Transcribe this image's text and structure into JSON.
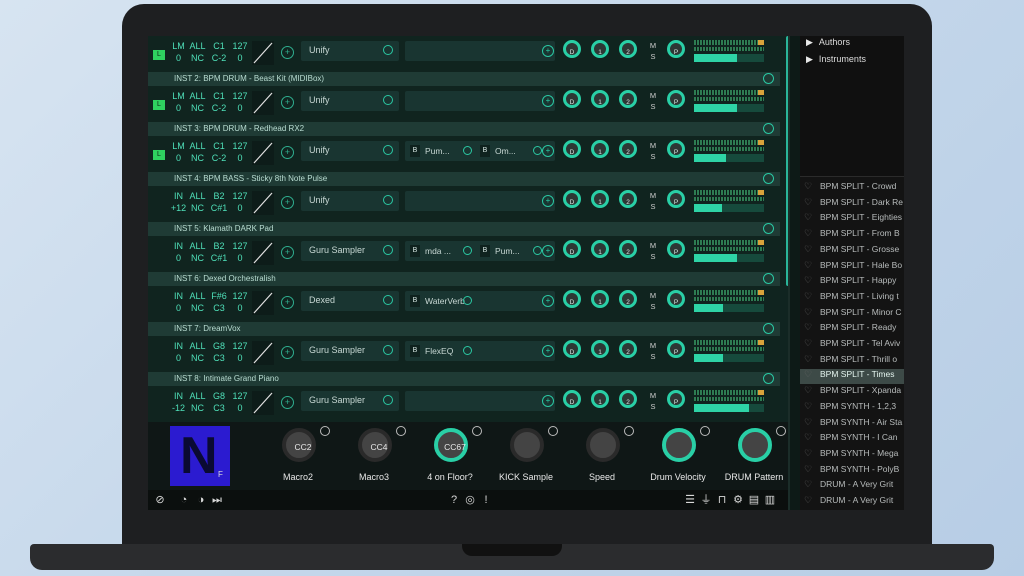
{
  "instruments": [
    {
      "header": "",
      "lm": [
        "LM",
        "ALL",
        "C1",
        "127"
      ],
      "row2": [
        "0",
        "NC",
        "C-2",
        "0"
      ],
      "led": "L",
      "plugin": "Unify",
      "fx": [],
      "fader": 0.62
    },
    {
      "header": "INST 2:  BPM DRUM - Beast Kit (MIDIBox)",
      "lm": [
        "LM",
        "ALL",
        "C1",
        "127"
      ],
      "row2": [
        "0",
        "NC",
        "C-2",
        "0"
      ],
      "led": "L",
      "plugin": "Unify",
      "fx": [],
      "fader": 0.62
    },
    {
      "header": "INST 3:  BPM DRUM - Redhead RX2",
      "lm": [
        "LM",
        "ALL",
        "C1",
        "127"
      ],
      "row2": [
        "0",
        "NC",
        "C-2",
        "0"
      ],
      "led": "L",
      "plugin": "Unify",
      "fx": [
        {
          "b": "B",
          "label": "Pum..."
        },
        {
          "b": "B",
          "label": "Om..."
        }
      ],
      "fader": 0.45
    },
    {
      "header": "INST 4:  BPM BASS - Sticky 8th Note Pulse",
      "lm": [
        "IN",
        "ALL",
        "B2",
        "127"
      ],
      "row2": [
        "+12",
        "NC",
        "C#1",
        "0"
      ],
      "led": "",
      "plugin": "Unify",
      "fx": [],
      "fader": 0.4
    },
    {
      "header": "INST 5:  Klamath DARK Pad",
      "lm": [
        "IN",
        "ALL",
        "B2",
        "127"
      ],
      "row2": [
        "0",
        "NC",
        "C#1",
        "0"
      ],
      "led": "",
      "plugin": "Guru Sampler",
      "fx": [
        {
          "b": "B",
          "label": "mda ..."
        },
        {
          "b": "B",
          "label": "Pum..."
        }
      ],
      "fader": 0.62
    },
    {
      "header": "INST 6:  Dexed Orchestralish",
      "lm": [
        "IN",
        "ALL",
        "F#6",
        "127"
      ],
      "row2": [
        "0",
        "NC",
        "C3",
        "0"
      ],
      "led": "",
      "plugin": "Dexed",
      "fx": [
        {
          "b": "B",
          "label": "WaterVerb"
        }
      ],
      "fader": 0.42
    },
    {
      "header": "INST 7:  DreamVox",
      "lm": [
        "IN",
        "ALL",
        "G8",
        "127"
      ],
      "row2": [
        "0",
        "NC",
        "C3",
        "0"
      ],
      "led": "",
      "plugin": "Guru Sampler",
      "fx": [
        {
          "b": "B",
          "label": "FlexEQ"
        }
      ],
      "fader": 0.42
    },
    {
      "header": "INST 8:  Intimate Grand Piano",
      "lm": [
        "IN",
        "ALL",
        "G8",
        "127"
      ],
      "row2": [
        "-12",
        "NC",
        "C3",
        "0"
      ],
      "led": "",
      "plugin": "Guru Sampler",
      "fx": [],
      "fader": 0.78
    }
  ],
  "knob_labels": [
    "D",
    "1",
    "2"
  ],
  "ms": [
    "M",
    "S"
  ],
  "pan_label": "P",
  "macros": [
    {
      "cc": "CC2",
      "label": "Macro2",
      "on": false
    },
    {
      "cc": "CC4",
      "label": "Macro3",
      "on": false
    },
    {
      "cc": "CC67",
      "label": "4 on Floor?",
      "on": true
    },
    {
      "cc": "",
      "label": "KICK Sample",
      "on": false
    },
    {
      "cc": "",
      "label": "Speed",
      "on": false
    },
    {
      "cc": "",
      "label": "Drum Velocity",
      "on": true
    },
    {
      "cc": "",
      "label": "DRUM Pattern",
      "on": true
    }
  ],
  "logo": {
    "letter": "N",
    "tail": "F"
  },
  "tree": [
    "Authors",
    "Instruments"
  ],
  "presets": [
    "BPM SPLIT - Crowd",
    "BPM SPLIT - Dark Re",
    "BPM SPLIT - Eighties",
    "BPM SPLIT - From B",
    "BPM SPLIT - Grosse",
    "BPM SPLIT - Hale Bo",
    "BPM SPLIT - Happy",
    "BPM SPLIT - Living t",
    "BPM SPLIT - Minor C",
    "BPM SPLIT - Ready",
    "BPM SPLIT - Tel Aviv",
    "BPM SPLIT - Thrill o",
    "BPM SPLIT - Times",
    "BPM SPLIT - Xpanda",
    "BPM SYNTH - 1,2,3",
    "BPM SYNTH - Air Sta",
    "BPM SYNTH - I Can",
    "BPM SYNTH - Mega",
    "BPM SYNTH - PolyB",
    "DRUM - A Very Grit",
    "DRUM - A Very Grit"
  ],
  "selected_preset": 12,
  "status_icons_left": [
    "no-icon",
    "tempo-icon",
    "tuner-icon",
    "skip-icon"
  ],
  "status_icons_mid": [
    "?",
    "◎",
    "!"
  ],
  "status_icons_right": [
    "list-icon",
    "plugin-icon",
    "lock-icon",
    "settings-icon",
    "layout-icon",
    "panel-icon"
  ],
  "colors": {
    "accent": "#29cfa6",
    "background": "#102420",
    "logo": "#2b1bd0"
  }
}
